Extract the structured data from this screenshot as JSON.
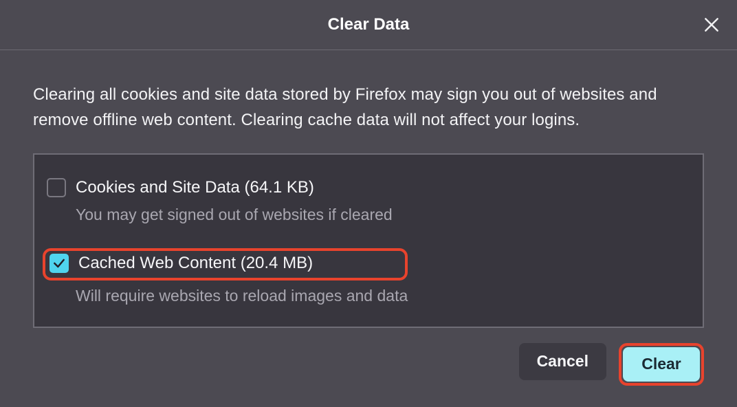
{
  "dialog": {
    "title": "Clear Data",
    "description": "Clearing all cookies and site data stored by Firefox may sign you out of websites and remove offline web content. Clearing cache data will not affect your logins."
  },
  "options": {
    "cookies": {
      "checked": false,
      "label": "Cookies and Site Data (64.1 KB)",
      "sub": "You may get signed out of websites if cleared"
    },
    "cache": {
      "checked": true,
      "label": "Cached Web Content (20.4 MB)",
      "sub": "Will require websites to reload images and data",
      "highlighted": true
    }
  },
  "buttons": {
    "cancel": "Cancel",
    "clear": "Clear",
    "clear_highlighted": true
  }
}
